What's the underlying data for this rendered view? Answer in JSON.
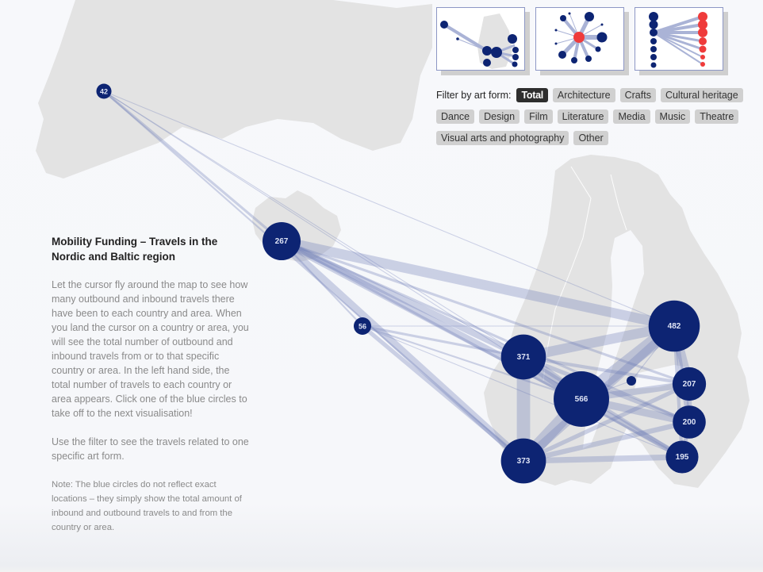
{
  "colors": {
    "node": "#0d2473",
    "flow": "#6c7bb8",
    "land": "#e3e3e3",
    "highlight_node": "#ef3b3b",
    "chip_bg": "#d0d0d0",
    "chip_active_bg": "#2e2e2e"
  },
  "views": [
    {
      "name": "map-view",
      "icon": "map-network-thumbnail-icon"
    },
    {
      "name": "radial-view",
      "icon": "radial-network-thumbnail-icon"
    },
    {
      "name": "bipartite-view",
      "icon": "bipartite-network-thumbnail-icon"
    }
  ],
  "filter": {
    "label": "Filter by art form:",
    "active": "Total",
    "options": [
      [
        "Total",
        "Architecture",
        "Crafts",
        "Cultural heritage"
      ],
      [
        "Dance",
        "Design",
        "Film",
        "Literature",
        "Media",
        "Music",
        "Theatre"
      ],
      [
        "Visual arts and photography",
        "Other"
      ]
    ]
  },
  "info": {
    "title": "Mobility Funding – Travels in the Nordic and Baltic region",
    "paragraph1": "Let the cursor fly around the map to see how many outbound and inbound travels there have been to each country and area. When you land the cursor on a country or area, you will see the total number of outbound and inbound travels from or to that specific country or area. In the left hand side, the total number of travels to each country or area appears. Click one of the blue circles to take off to the next visualisation!",
    "paragraph2": "Use the filter to see the travels related to one specific art form.",
    "note": "Note: The blue circles do not reflect exact locations – they simply show the total amount of inbound and outbound travels to and from the country or area."
  },
  "chart_data": {
    "type": "network-map",
    "title": "Mobility Funding – Travels in the Nordic and Baltic region",
    "nodes": [
      {
        "id": "greenland",
        "value": 42
      },
      {
        "id": "iceland",
        "value": 267
      },
      {
        "id": "faroe",
        "value": 56
      },
      {
        "id": "norway",
        "value": 371
      },
      {
        "id": "sweden",
        "value": 566
      },
      {
        "id": "finland",
        "value": 482
      },
      {
        "id": "aland",
        "value": null
      },
      {
        "id": "estonia",
        "value": 207
      },
      {
        "id": "latvia",
        "value": 200
      },
      {
        "id": "lithuania",
        "value": 195
      },
      {
        "id": "denmark",
        "value": 373
      }
    ],
    "links": [
      {
        "source": "greenland",
        "target": "iceland",
        "weight": 3
      },
      {
        "source": "greenland",
        "target": "denmark",
        "weight": 2
      },
      {
        "source": "greenland",
        "target": "sweden",
        "weight": 1
      },
      {
        "source": "greenland",
        "target": "finland",
        "weight": 1
      },
      {
        "source": "greenland",
        "target": "norway",
        "weight": 1
      },
      {
        "source": "iceland",
        "target": "denmark",
        "weight": 9
      },
      {
        "source": "iceland",
        "target": "sweden",
        "weight": 9
      },
      {
        "source": "iceland",
        "target": "norway",
        "weight": 8
      },
      {
        "source": "iceland",
        "target": "finland",
        "weight": 12
      },
      {
        "source": "iceland",
        "target": "estonia",
        "weight": 3
      },
      {
        "source": "iceland",
        "target": "latvia",
        "weight": 3
      },
      {
        "source": "iceland",
        "target": "lithuania",
        "weight": 3
      },
      {
        "source": "iceland",
        "target": "faroe",
        "weight": 2
      },
      {
        "source": "faroe",
        "target": "denmark",
        "weight": 5
      },
      {
        "source": "faroe",
        "target": "norway",
        "weight": 3
      },
      {
        "source": "faroe",
        "target": "sweden",
        "weight": 2
      },
      {
        "source": "faroe",
        "target": "finland",
        "weight": 1
      },
      {
        "source": "faroe",
        "target": "lithuania",
        "weight": 1
      },
      {
        "source": "norway",
        "target": "denmark",
        "weight": 16
      },
      {
        "source": "norway",
        "target": "sweden",
        "weight": 14
      },
      {
        "source": "norway",
        "target": "finland",
        "weight": 12
      },
      {
        "source": "norway",
        "target": "estonia",
        "weight": 4
      },
      {
        "source": "norway",
        "target": "latvia",
        "weight": 5
      },
      {
        "source": "norway",
        "target": "lithuania",
        "weight": 4
      },
      {
        "source": "sweden",
        "target": "finland",
        "weight": 18
      },
      {
        "source": "sweden",
        "target": "denmark",
        "weight": 16
      },
      {
        "source": "sweden",
        "target": "estonia",
        "weight": 8
      },
      {
        "source": "sweden",
        "target": "latvia",
        "weight": 9
      },
      {
        "source": "sweden",
        "target": "lithuania",
        "weight": 7
      },
      {
        "source": "finland",
        "target": "estonia",
        "weight": 10
      },
      {
        "source": "finland",
        "target": "latvia",
        "weight": 6
      },
      {
        "source": "finland",
        "target": "denmark",
        "weight": 10
      },
      {
        "source": "finland",
        "target": "lithuania",
        "weight": 4
      },
      {
        "source": "denmark",
        "target": "estonia",
        "weight": 5
      },
      {
        "source": "denmark",
        "target": "latvia",
        "weight": 6
      },
      {
        "source": "denmark",
        "target": "lithuania",
        "weight": 7
      },
      {
        "source": "estonia",
        "target": "latvia",
        "weight": 6
      },
      {
        "source": "latvia",
        "target": "lithuania",
        "weight": 5
      },
      {
        "source": "aland",
        "target": "sweden",
        "weight": 1
      },
      {
        "source": "aland",
        "target": "finland",
        "weight": 1
      }
    ]
  }
}
